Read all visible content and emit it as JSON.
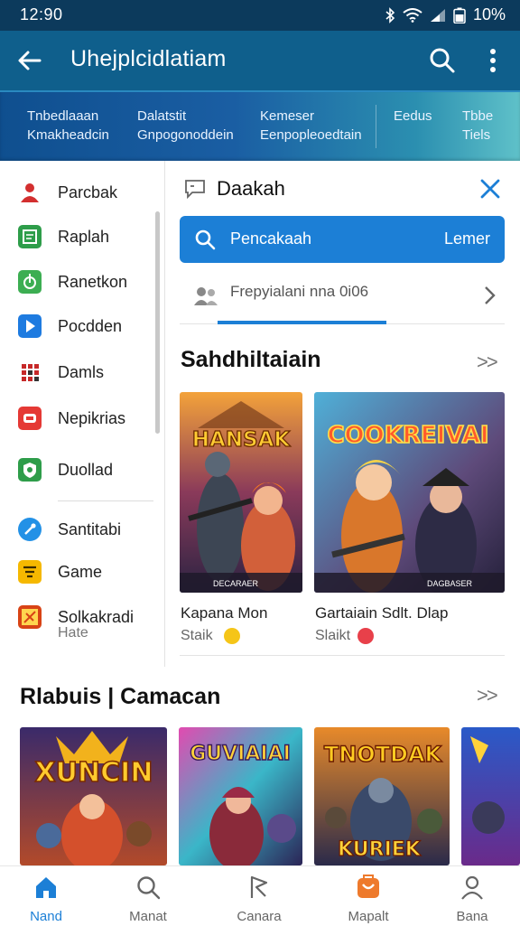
{
  "status_bar": {
    "time": "12:90",
    "battery": "10%"
  },
  "app_bar": {
    "title": "Uhejplcidlatiam"
  },
  "top_tabs": [
    {
      "line1": "Tnbedlaaan",
      "line2": "Kmakheadcin"
    },
    {
      "line1": "Dalatstit",
      "line2": "Gnpogonoddein"
    },
    {
      "line1": "Kemeser",
      "line2": "Eenpopleoedtain"
    },
    {
      "line1": "",
      "line2": "Eedus"
    },
    {
      "line1": "Tbbe",
      "line2": "Tiels"
    }
  ],
  "sidebar": {
    "items": [
      {
        "label": "Parcbak",
        "icon": "person-icon",
        "color": "#d32f2f"
      },
      {
        "label": "Raplah",
        "icon": "document-icon",
        "color": "#2e9d4a"
      },
      {
        "label": "Ranetkon",
        "icon": "leaf-icon",
        "color": "#3cae52"
      },
      {
        "label": "Pocdden",
        "icon": "play-icon",
        "color": "#1e7be0"
      },
      {
        "label": "Damls",
        "icon": "grid-icon",
        "color": "#c62828"
      },
      {
        "label": "Nepikrias",
        "icon": "youtube-icon",
        "color": "#e53935"
      },
      {
        "label": "Duollad",
        "icon": "shield-icon",
        "color": "#2e9d4a"
      },
      {
        "label": "Santitabi",
        "icon": "compass-icon",
        "color": "#2391e6"
      },
      {
        "label": "Game",
        "icon": "game-icon",
        "color": "#f5b800"
      },
      {
        "label": "Solkakradi",
        "icon": "tag-icon",
        "color": "#d84315"
      }
    ],
    "last_sub": "Hate"
  },
  "panel": {
    "title": "Daakah",
    "search": {
      "placeholder": "Pencakaah",
      "button": "Lemer"
    },
    "pending": {
      "text": "Frepyialani nna 0i06",
      "progress": 0.52
    }
  },
  "section1": {
    "title": "Sahdhiltaiain",
    "more": ">>",
    "cards": [
      {
        "art": "HANSAK",
        "badge": "DECARAER",
        "title": "Kapana Mon",
        "sub": "Staik"
      },
      {
        "art": "COOKREIVAI",
        "badge": "DAGBASER",
        "title": "Gartaiain Sdlt. Dlap",
        "sub": "Slaikt"
      }
    ]
  },
  "section2": {
    "title": "Rlabuis | Camacan",
    "more": ">>",
    "cards": [
      {
        "art": "XUNCIN"
      },
      {
        "art": "GUVIAIAI"
      },
      {
        "art": "TNOTDAK",
        "art2": "KURIEK"
      },
      {
        "art": ""
      }
    ]
  },
  "bottom_nav": [
    {
      "label": "Nand",
      "icon": "home-icon",
      "active": true
    },
    {
      "label": "Manat",
      "icon": "search-icon",
      "active": false
    },
    {
      "label": "Canara",
      "icon": "flag-icon",
      "active": false
    },
    {
      "label": "Mapalt",
      "icon": "store-icon",
      "active": false
    },
    {
      "label": "Bana",
      "icon": "person-icon",
      "active": false
    }
  ],
  "colors": {
    "primary": "#0f5f8c",
    "accent": "#1c7fd6",
    "status_bar": "#0c3a5c"
  }
}
